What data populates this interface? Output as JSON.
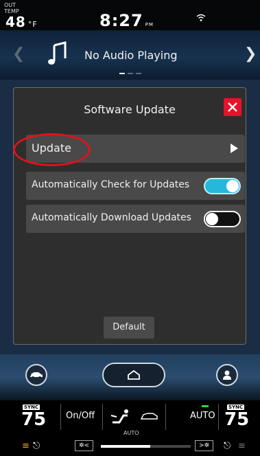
{
  "status": {
    "out_temp_label": "OUT TEMP",
    "out_temp_value": "48",
    "out_temp_unit": "°F",
    "time": "8:27",
    "ampm": "PM"
  },
  "audio": {
    "title": "No Audio Playing",
    "prev_icon": "chevron-left-icon",
    "next_icon": "chevron-right-icon",
    "page_dots": 3,
    "active_dot": 1
  },
  "dialog": {
    "title": "Software Update",
    "rows": [
      {
        "label": "Update",
        "control": "arrow"
      },
      {
        "label": "Automatically Check for Updates",
        "control": "toggle",
        "on": true
      },
      {
        "label": "Automatically Download Updates",
        "control": "toggle",
        "on": false
      }
    ],
    "default_label": "Default"
  },
  "colors": {
    "close_red": "#e4132a",
    "toggle_on": "#25b8dc",
    "highlight_ring": "#e0121b",
    "auto_led": "#2fd63c"
  },
  "climate": {
    "sync_label": "SYNC",
    "left_temp": "75",
    "right_temp": "75",
    "onoff_label": "On/Off",
    "auto_label": "AUTO",
    "auto_small_label": "AUTO",
    "fan_down_label": "✲<",
    "fan_up_label": ">✲",
    "fan_level_fraction": 0.55
  }
}
